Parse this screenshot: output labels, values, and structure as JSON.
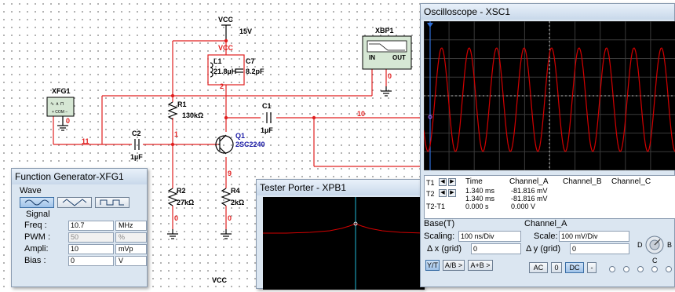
{
  "schematic": {
    "vcc_top": "VCC",
    "vcc_value": "15V",
    "vcc_node": "VCC",
    "l1_name": "L1",
    "l1_value": "21.8µH",
    "c7_name": "C7",
    "c7_value": "8.2pF",
    "node_2": "2",
    "r1_name": "R1",
    "r1_value": "130kΩ",
    "c1_name": "C1",
    "c1_value": "1µF",
    "node_10": "10",
    "q1_name": "Q1",
    "q1_model": "2SC2240",
    "node_1": "1",
    "c2_name": "C2",
    "c2_value": "1µF",
    "node_11": "11",
    "node_9": "9",
    "r2_name": "R2",
    "r2_value": "27kΩ",
    "r4_name": "R4",
    "r4_value": "2kΩ",
    "gnd_node_0a": "0",
    "gnd_node_0b": "0",
    "gnd_node_0c": "0",
    "gnd_node_0d": "0",
    "xfg1_label": "XFG1",
    "xbp1_label": "XBP1",
    "xbp1_in": "IN",
    "xbp1_out": "OUT",
    "vcc_bottom": "VCC"
  },
  "function_generator": {
    "title": "Function Generator-XFG1",
    "wave_label": "Wave",
    "signal_label": "Signal",
    "waves": [
      "sine-wave-icon",
      "triangle-wave-icon",
      "square-wave-icon"
    ],
    "selected_wave": 0,
    "freq_label": "Freq :",
    "freq_value": "10.7",
    "freq_unit": "MHz",
    "pwm_label": "PWM :",
    "pwm_value": "50",
    "pwm_unit": "%",
    "ampli_label": "Ampli:",
    "ampli_value": "10",
    "ampli_unit": "mVp",
    "bias_label": "Bias :",
    "bias_value": "0",
    "bias_unit": "V"
  },
  "tester_porter": {
    "title": "Tester Porter - XPB1"
  },
  "oscilloscope": {
    "title": "Oscilloscope - XSC1",
    "trace_color": "#d40000",
    "columns": [
      "Time",
      "Channel_A",
      "Channel_B",
      "Channel_C"
    ],
    "t1_label": "T1",
    "t1_time": "1.340 ms",
    "t1_cha": "-81.816 mV",
    "t2_label": "T2",
    "t2_time": "1.340 ms",
    "t2_cha": "-81.816 mV",
    "t21_label": "T2-T1",
    "t21_time": "0.000 s",
    "t21_cha": "0.000 V",
    "base_label": "Base(T)",
    "scaling_label": "Scaling:",
    "scaling_value": "100 ns/Div",
    "dx_label": "Δ x (grid)",
    "dx_value": "0",
    "channel_a_label": "Channel_A",
    "scale_label": "Scale:",
    "scale_value": "100 mV/Div",
    "dy_label": "Δ y (grid)",
    "dy_value": "0",
    "yt_label": "Y/T",
    "ab_label": "A/B >",
    "aplusb_label": "A+B >",
    "ac_label": "AC",
    "zero_label": "0",
    "dc_label": "DC",
    "minus_label": "-",
    "knob_d": "D",
    "knob_b": "B",
    "knob_c": "C"
  }
}
